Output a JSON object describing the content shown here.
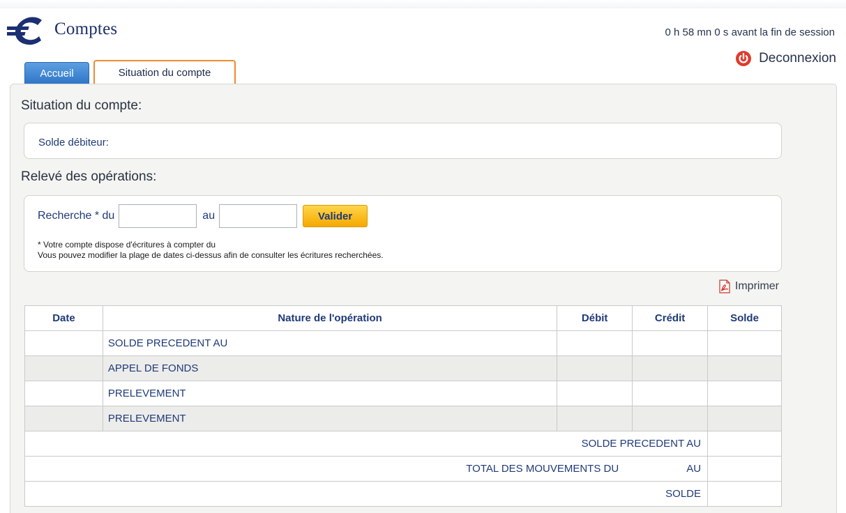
{
  "header": {
    "title": "Comptes",
    "logo_icon": "euro-icon",
    "session_timer": "0 h 58 mn 0 s avant la fin de session",
    "logout_label": "Deconnexion",
    "logout_icon": "power-icon"
  },
  "tabs": [
    {
      "label": "Accueil",
      "active": false
    },
    {
      "label": "Situation du compte",
      "active": true
    }
  ],
  "account_status": {
    "heading": "Situation du compte:",
    "balance_label": "Solde débiteur:"
  },
  "operations": {
    "heading": "Relevé des opérations:",
    "search": {
      "label_from": "Recherche * du",
      "label_to": "au",
      "from_value": "",
      "to_value": "",
      "validate_label": "Valider"
    },
    "notes": [
      "* Votre compte dispose d'écritures à compter du",
      "Vous pouvez modifier la plage de dates ci-dessus afin de consulter les écritures recherchées."
    ],
    "print_label": "Imprimer",
    "print_icon": "pdf-icon",
    "table": {
      "columns": [
        "Date",
        "Nature de l'opération",
        "Débit",
        "Crédit",
        "Solde"
      ],
      "rows": [
        {
          "date": "",
          "nature": "SOLDE PRECEDENT AU",
          "debit": "",
          "credit": "",
          "solde": ""
        },
        {
          "date": "",
          "nature": "APPEL DE FONDS",
          "debit": "",
          "credit": "",
          "solde": ""
        },
        {
          "date": "",
          "nature": "PRELEVEMENT",
          "debit": "",
          "credit": "",
          "solde": ""
        },
        {
          "date": "",
          "nature": "PRELEVEMENT",
          "debit": "",
          "credit": "",
          "solde": ""
        }
      ],
      "summary": {
        "previous_balance": "SOLDE PRECEDENT AU",
        "total_movements": "TOTAL DES MOUVEMENTS DU",
        "total_movements_to": "AU",
        "balance": "SOLDE"
      }
    }
  },
  "colors": {
    "tab_home": "#2f76c8",
    "tab_active_border": "#f08a2e",
    "validate_button": "#f5a800",
    "power_icon": "#e03a2a",
    "text_blue": "#1f3a78"
  }
}
